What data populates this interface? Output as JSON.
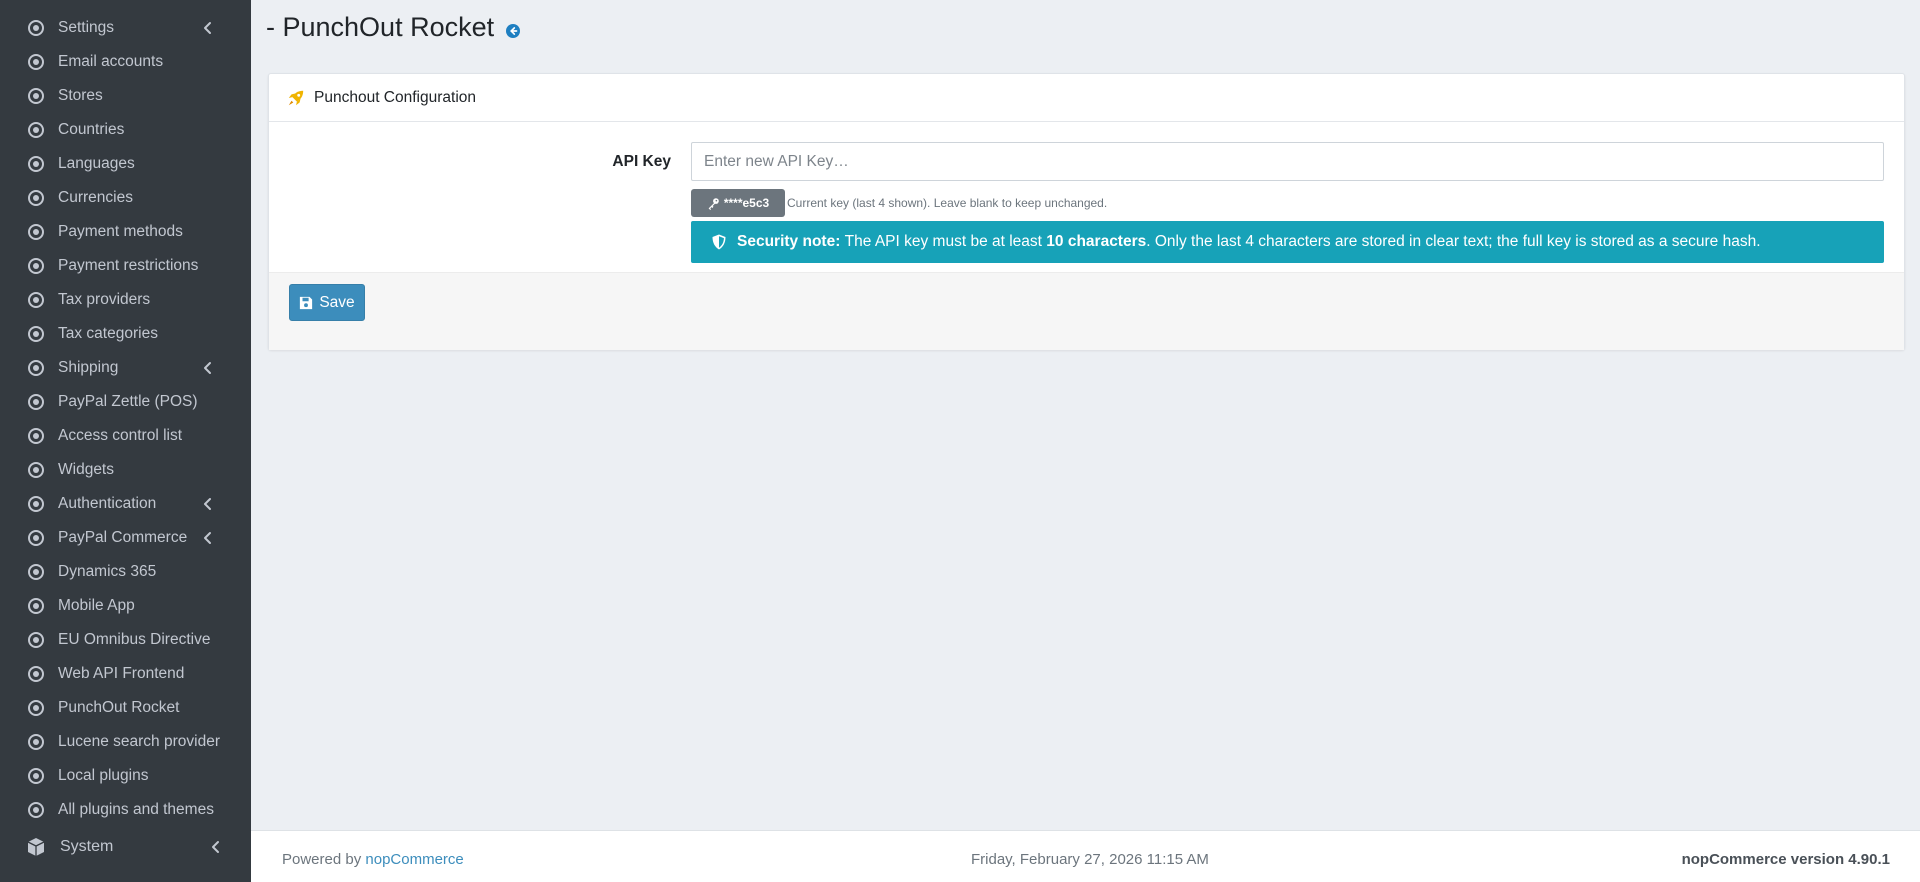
{
  "sidebar": {
    "items": [
      {
        "label": "Settings",
        "has_submenu": true
      },
      {
        "label": "Email accounts",
        "has_submenu": false
      },
      {
        "label": "Stores",
        "has_submenu": false
      },
      {
        "label": "Countries",
        "has_submenu": false
      },
      {
        "label": "Languages",
        "has_submenu": false
      },
      {
        "label": "Currencies",
        "has_submenu": false
      },
      {
        "label": "Payment methods",
        "has_submenu": false
      },
      {
        "label": "Payment restrictions",
        "has_submenu": false
      },
      {
        "label": "Tax providers",
        "has_submenu": false
      },
      {
        "label": "Tax categories",
        "has_submenu": false
      },
      {
        "label": "Shipping",
        "has_submenu": true
      },
      {
        "label": "PayPal Zettle (POS)",
        "has_submenu": false
      },
      {
        "label": "Access control list",
        "has_submenu": false
      },
      {
        "label": "Widgets",
        "has_submenu": false
      },
      {
        "label": "Authentication",
        "has_submenu": true
      },
      {
        "label": "PayPal Commerce",
        "has_submenu": true
      },
      {
        "label": "Dynamics 365",
        "has_submenu": false
      },
      {
        "label": "Mobile App",
        "has_submenu": false
      },
      {
        "label": "EU Omnibus Directive",
        "has_submenu": false
      },
      {
        "label": "Web API Frontend",
        "has_submenu": false
      },
      {
        "label": "PunchOut Rocket",
        "has_submenu": false
      },
      {
        "label": "Lucene search provider",
        "has_submenu": false
      },
      {
        "label": "Local plugins",
        "has_submenu": false
      },
      {
        "label": "All plugins and themes",
        "has_submenu": false
      }
    ],
    "system_label": "System"
  },
  "header": {
    "title": "- PunchOut Rocket",
    "back_icon": "arrow-circle-left-icon"
  },
  "card": {
    "title": "Punchout Configuration",
    "title_icon": "rocket-icon",
    "api_key_label": "API Key",
    "api_key_value": "",
    "api_key_placeholder": "Enter new API Key…",
    "current_key_masked": "****e5c3",
    "current_key_hint": "Current key (last 4 shown). Leave blank to keep unchanged.",
    "security_note": {
      "label": "Security note:",
      "text_before": "The API key must be at least ",
      "emphasis": "10 characters",
      "text_after": ". Only the last 4 characters are stored in clear text; the full key is stored as a secure hash."
    },
    "save_label": "Save"
  },
  "footer": {
    "powered_prefix": "Powered by ",
    "powered_link": "nopCommerce",
    "datetime": "Friday, February 27, 2026 11:15 AM",
    "version": "nopCommerce version 4.90.1"
  },
  "colors": {
    "sidebar_bg": "#343a40",
    "accent": "#3c8dbc",
    "info": "#17a2b8",
    "badge": "#6c757d",
    "rocket": "#f0b400"
  }
}
